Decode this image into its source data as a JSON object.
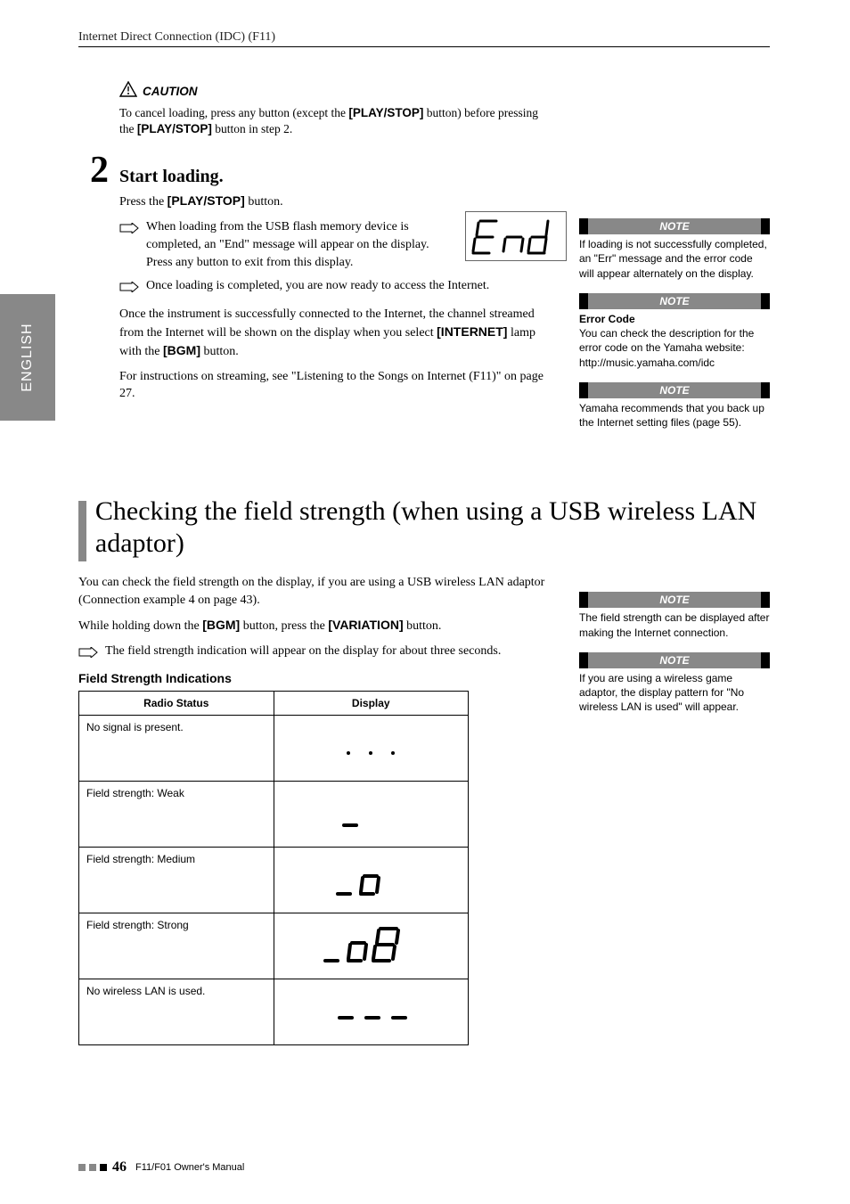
{
  "header": {
    "title": "Internet Direct Connection (IDC) (F11)"
  },
  "language_tab": "ENGLISH",
  "caution": {
    "label": "CAUTION",
    "text_parts": {
      "a": "To cancel loading, press any button (except the ",
      "b": "[PLAY/STOP]",
      "c": " button) before pressing the ",
      "d": "[PLAY/STOP]",
      "e": " button in step 2."
    }
  },
  "step2": {
    "number": "2",
    "title": "Start loading.",
    "press_line": {
      "a": "Press the ",
      "b": "[PLAY/STOP]",
      "c": " button."
    },
    "end_text": "When loading from the USB flash memory device is completed, an \"End\" message will appear on the display. Press any button to exit from this display.",
    "ready_text": "Once loading is completed, you are now ready to access the Internet.",
    "connected_parts": {
      "a": "Once the instrument is successfully connected to the Internet, the channel streamed from the Internet will be shown on the display when you select ",
      "b": "[INTERNET]",
      "c": " lamp with the ",
      "d": "[BGM]",
      "e": " button."
    },
    "instructions": "For instructions on streaming, see \"Listening to the Songs on Internet (F11)\" on page 27."
  },
  "section2": {
    "title": "Checking the field strength (when using a USB wireless LAN adaptor)",
    "p1": "You can check the field strength on the display, if you are using a USB wireless LAN adaptor (Connection example 4 on page 43).",
    "p2_parts": {
      "a": "While holding down the ",
      "b": "[BGM]",
      "c": " button, press the ",
      "d": "[VARIATION]",
      "e": " button."
    },
    "arrow": "The field strength indication will appear on the display for about three seconds.",
    "table_heading": "Field Strength Indications",
    "table": {
      "col1": "Radio Status",
      "col2": "Display",
      "rows": [
        {
          "status": "No signal is present."
        },
        {
          "status": "Field strength: Weak"
        },
        {
          "status": "Field strength: Medium"
        },
        {
          "status": "Field strength: Strong"
        },
        {
          "status": "No wireless LAN is used."
        }
      ]
    }
  },
  "notes": {
    "label": "NOTE",
    "n1": "If loading is not successfully completed, an \"Err\" message and the error code will appear alternately on the display.",
    "n2_title": "Error Code",
    "n2_body": "You can check the description for the error code on the Yamaha website:",
    "n2_url": "http://music.yamaha.com/idc",
    "n3": "Yamaha recommends that you back up the Internet setting files (page 55).",
    "n4": "The field strength can be displayed after making the Internet connection.",
    "n5": "If you are using a wireless game adaptor, the display pattern for \"No wireless LAN is used\" will appear."
  },
  "footer": {
    "page": "46",
    "manual": "F11/F01 Owner's Manual"
  }
}
